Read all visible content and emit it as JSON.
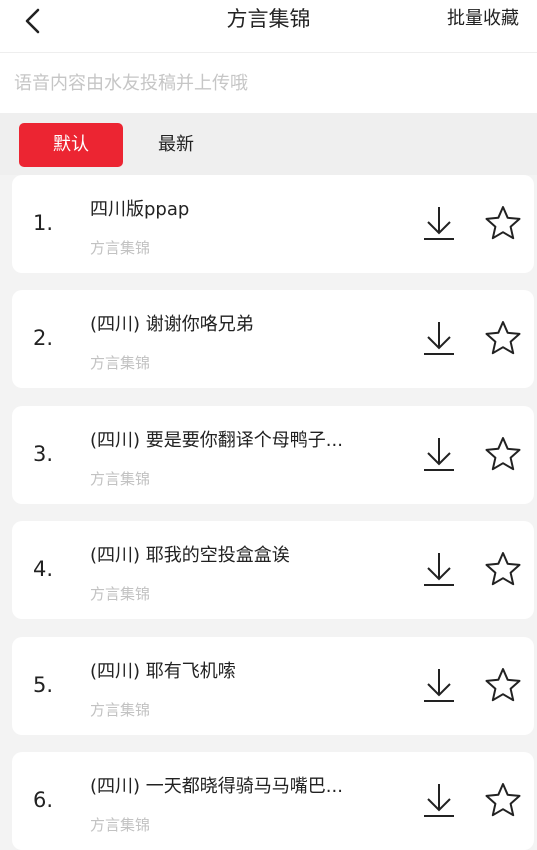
{
  "header": {
    "title": "方言集锦",
    "batch_label": "批量收藏"
  },
  "notice": "语音内容由水友投稿并上传哦",
  "tabs": [
    {
      "label": "默认",
      "active": true
    },
    {
      "label": "最新",
      "active": false
    }
  ],
  "items": [
    {
      "index": "1.",
      "title": "四川版ppap",
      "subtitle": "方言集锦"
    },
    {
      "index": "2.",
      "title": "(四川) 谢谢你咯兄弟",
      "subtitle": "方言集锦"
    },
    {
      "index": "3.",
      "title": "(四川) 要是要你翻译个母鸭子...",
      "subtitle": "方言集锦"
    },
    {
      "index": "4.",
      "title": "(四川) 耶我的空投盒盒诶",
      "subtitle": "方言集锦"
    },
    {
      "index": "5.",
      "title": "(四川) 耶有飞机嗦",
      "subtitle": "方言集锦"
    },
    {
      "index": "6.",
      "title": "(四川) 一天都晓得骑马马嘴巴...",
      "subtitle": "方言集锦"
    }
  ],
  "icons": {
    "back": "back-arrow-icon",
    "download": "download-icon",
    "favorite": "star-outline-icon"
  },
  "colors": {
    "accent": "#ec2532",
    "background": "#f3f3f3",
    "card": "#ffffff",
    "muted_text": "#c2c2c2"
  }
}
